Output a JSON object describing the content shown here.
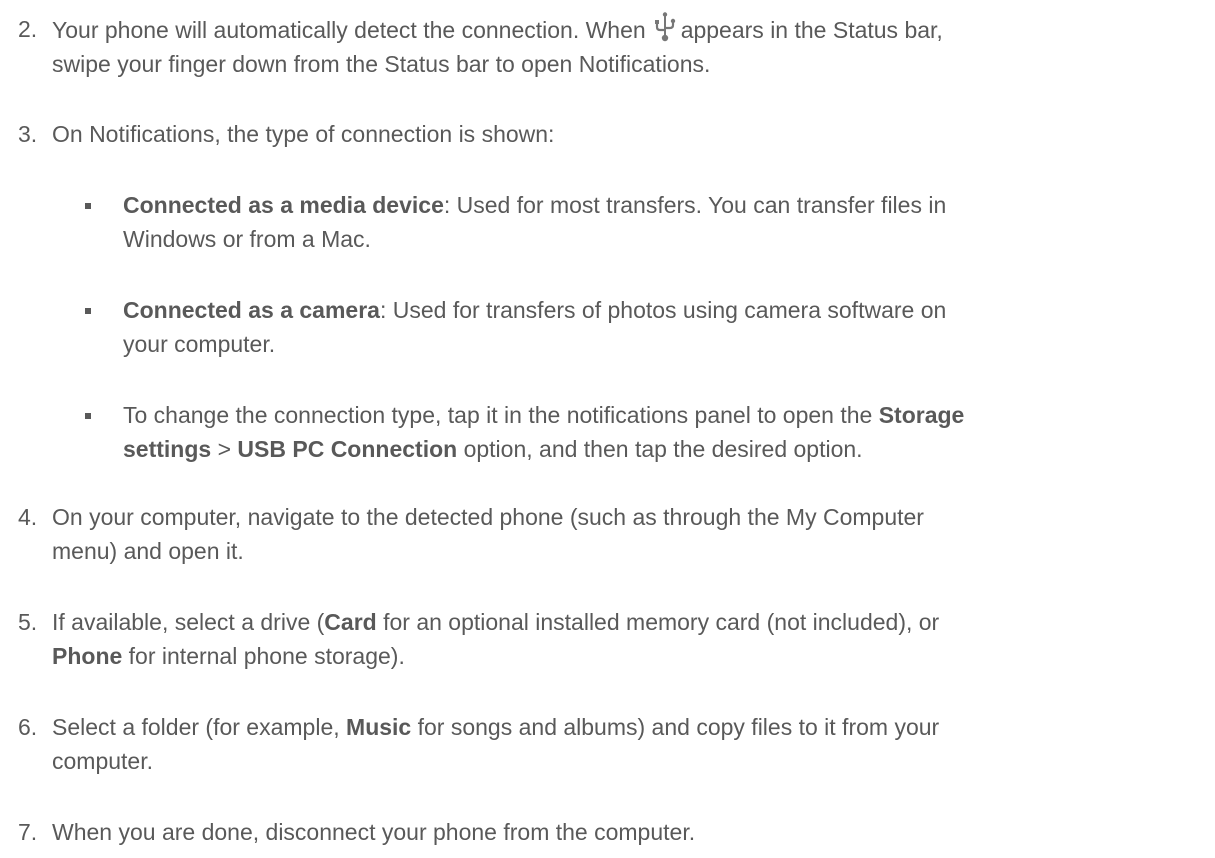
{
  "steps": [
    {
      "number": "2.",
      "part1": "Your phone will automatically detect the connection. When",
      "icon": "usb-icon",
      "part2": "appears in the Status bar,",
      "line2": "swipe your finger down from the Status bar to open Notifications."
    },
    {
      "number": "3.",
      "line1": "On Notifications, the type of connection is shown:"
    },
    {
      "number": "4.",
      "line1": "On your computer, navigate to the detected phone (such as through the My Computer",
      "line2": "menu) and open it."
    },
    {
      "number": "5.",
      "line1_a": "If available, select a drive (",
      "line1_b": "Card",
      "line1_c": " for an optional installed memory card (not included), or",
      "line2_a": "Phone",
      "line2_b": " for internal phone storage)."
    },
    {
      "number": "6.",
      "line1_a": "Select a folder (for example, ",
      "line1_b": "Music",
      "line1_c": " for songs and albums) and copy files to it from your",
      "line2": "computer."
    },
    {
      "number": "7.",
      "line1": "When you are done, disconnect your phone from the computer."
    }
  ],
  "bullets": [
    {
      "bold": "Connected as a media device",
      "line1_rest": ": Used for most transfers. You can transfer files in",
      "line2": "Windows or from a Mac."
    },
    {
      "bold": "Connected as a camera",
      "line1_rest": ": Used for transfers of photos using camera software on",
      "line2": "your computer."
    },
    {
      "line1_a": "To change the connection type, tap it in the notifications panel to open the ",
      "line1_b": "Storage",
      "line2_a": "settings",
      "line2_b": " > ",
      "line2_c": "USB PC Connection",
      "line2_d": " option, and then tap the desired option."
    }
  ],
  "colors": {
    "text": "#595959",
    "background": "#ffffff"
  }
}
